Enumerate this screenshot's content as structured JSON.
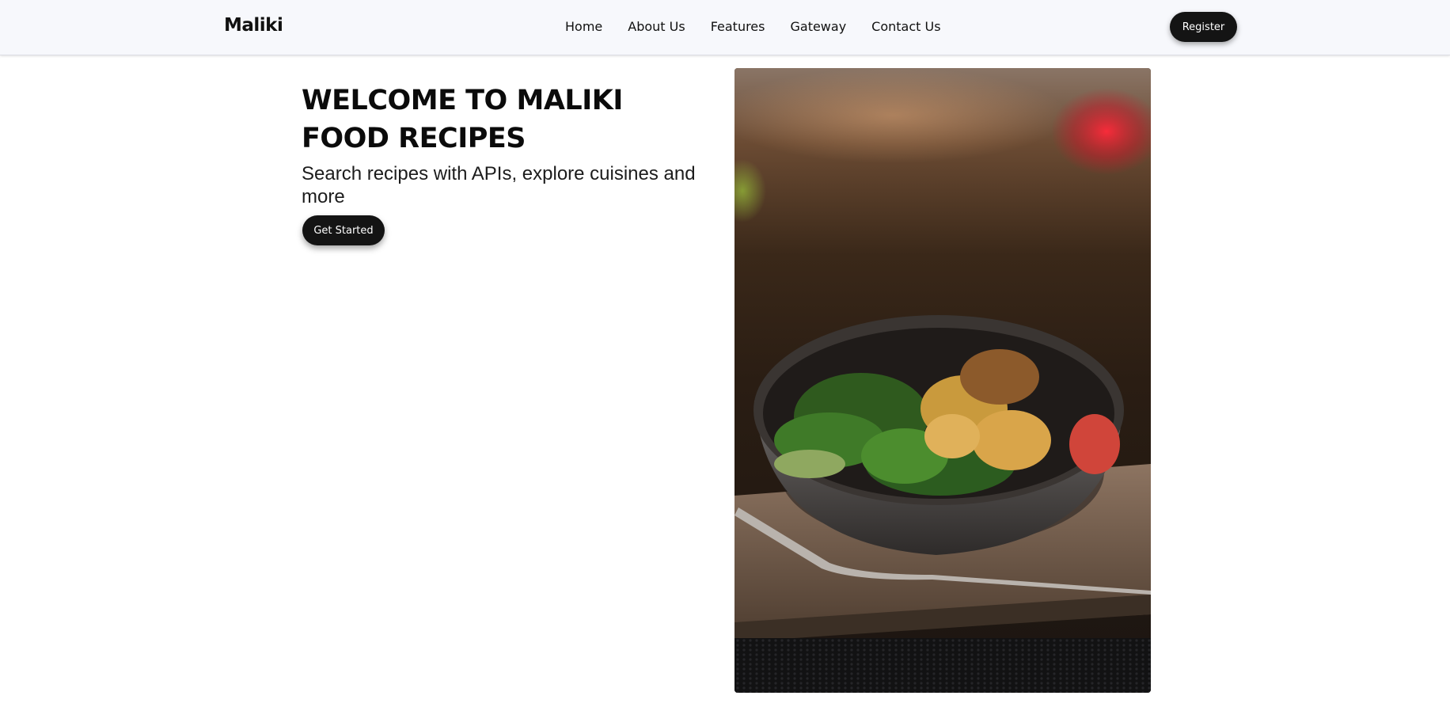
{
  "brand": {
    "name": "Maliki"
  },
  "nav": {
    "links": [
      "Home",
      "About Us",
      "Features",
      "Gateway",
      "Contact Us"
    ],
    "register_label": "Register"
  },
  "hero": {
    "title": "WELCOME TO MALIKI FOOD RECIPES",
    "subtitle": "Search recipes with APIs, explore cuisines and more",
    "cta_label": "Get Started",
    "image": {
      "depicts": "salad bowl with dumplings and fork on wooden board"
    }
  },
  "colors": {
    "navbar_bg": "#f7f8fc",
    "button_bg": "#141414",
    "button_text": "#ffffff",
    "text": "#111111"
  }
}
